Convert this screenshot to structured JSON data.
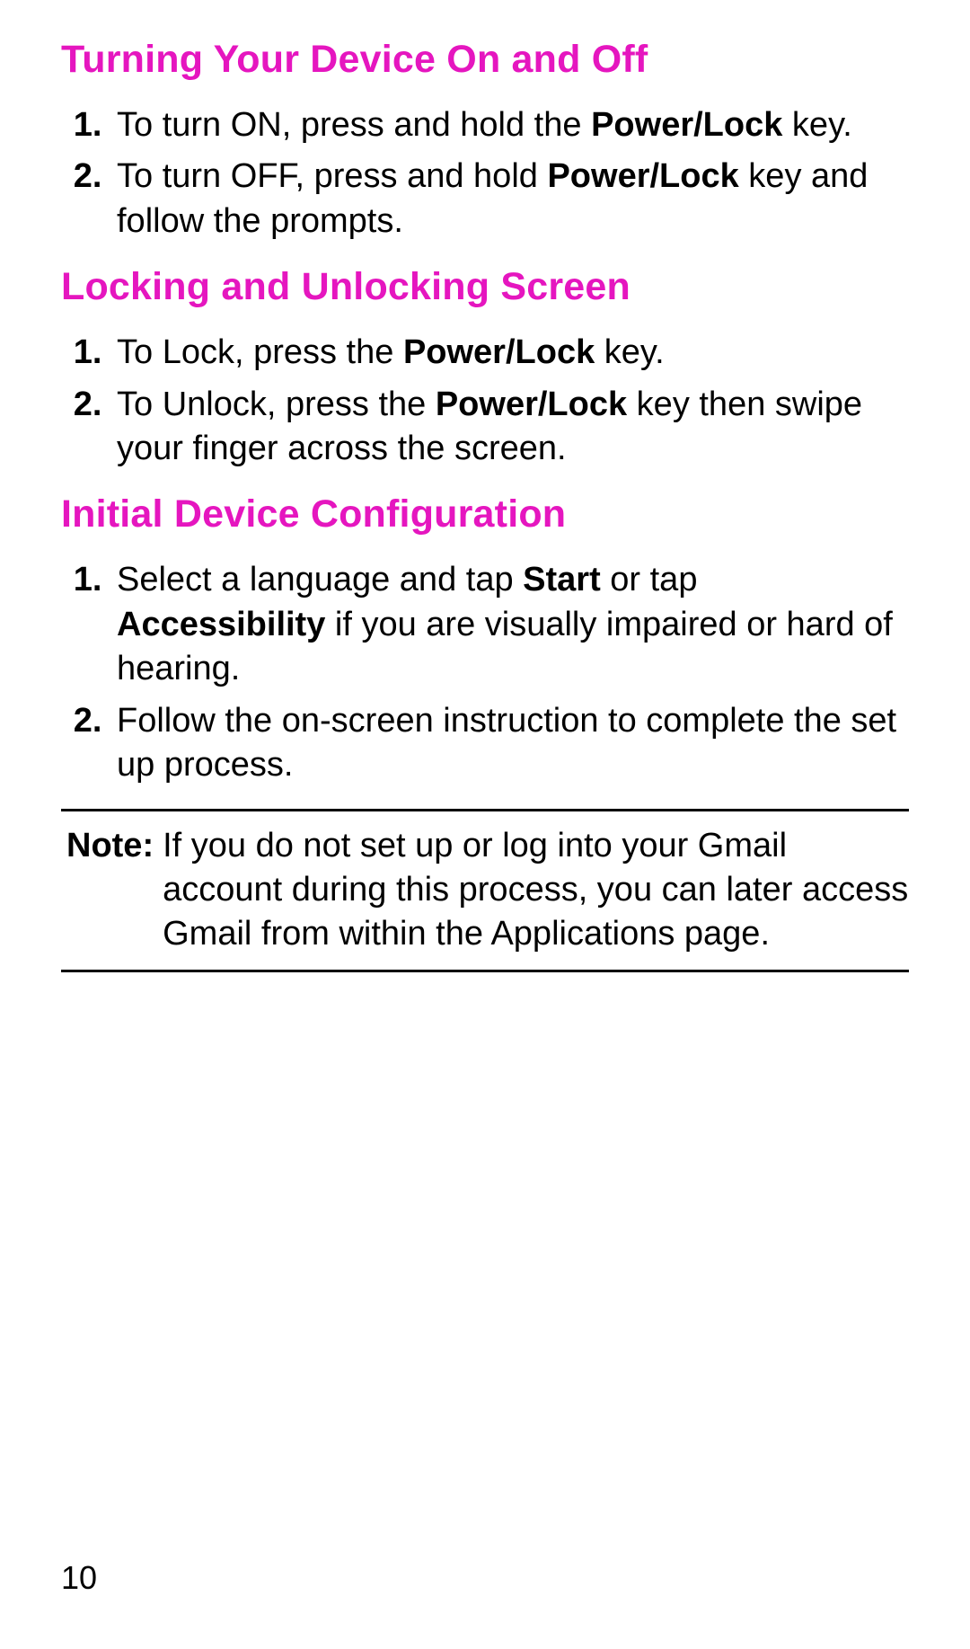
{
  "sections": [
    {
      "heading": "Turning Your Device On and Off",
      "items": [
        {
          "pre": "To turn ON, press and hold the ",
          "bold": "Power/Lock",
          "post": " key."
        },
        {
          "pre": "To turn OFF, press and hold ",
          "bold": "Power/Lock",
          "post": " key and follow the prompts."
        }
      ]
    },
    {
      "heading": "Locking and Unlocking Screen",
      "items": [
        {
          "pre": "To Lock, press the ",
          "bold": "Power/Lock",
          "post": " key."
        },
        {
          "pre": "To Unlock, press the ",
          "bold": "Power/Lock",
          "post": " key then swipe your finger across the screen."
        }
      ]
    },
    {
      "heading": "Initial Device Configuration",
      "items": [
        {
          "pre": "Select a language and tap ",
          "bold": "Start",
          "post": " or tap ",
          "bold2": "Accessibility",
          "post2": " if you are visually impaired or hard of hearing."
        },
        {
          "pre": "Follow the on-screen instruction to complete the set up process.",
          "bold": "",
          "post": ""
        }
      ]
    }
  ],
  "note": {
    "label": "Note:",
    "body": "If you do not set up or log into your Gmail account during this process, you can later access Gmail from within the Applications page."
  },
  "page_number": "10"
}
